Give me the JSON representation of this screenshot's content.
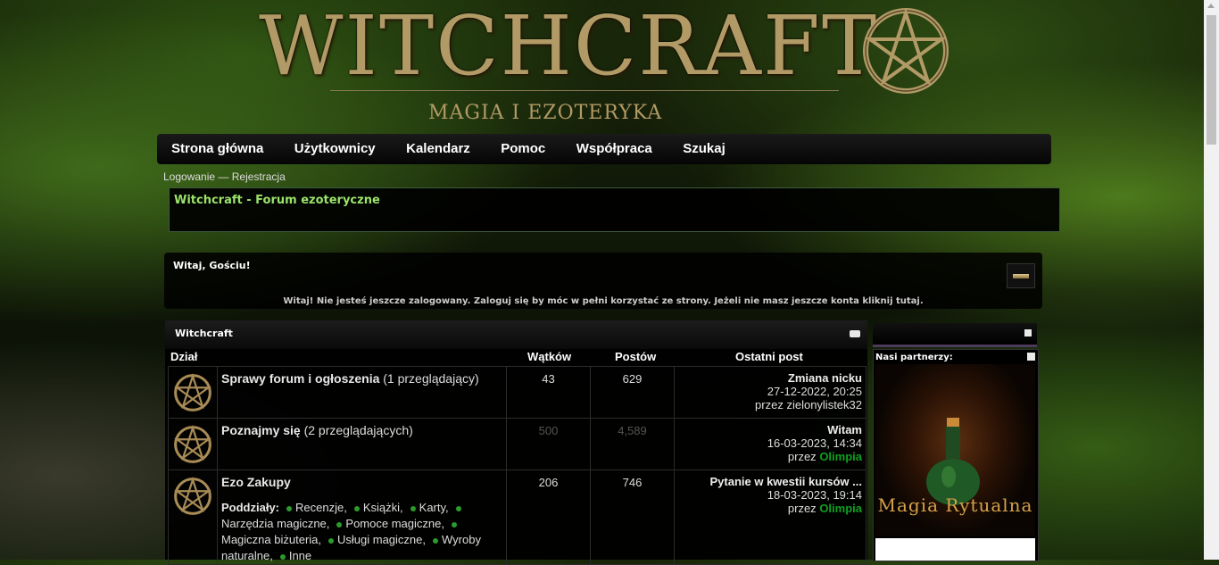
{
  "header": {
    "logo_title": "WITCHCRAFT",
    "logo_subtitle": "MAGIA I EZOTERYKA"
  },
  "nav": {
    "items": [
      "Strona główna",
      "Użytkownicy",
      "Kalendarz",
      "Pomoc",
      "Współpraca",
      "Szukaj"
    ]
  },
  "auth": {
    "login": "Logowanie",
    "separator": "—",
    "register": "Rejestracja"
  },
  "forum_title": "Witchcraft - Forum ezoteryczne",
  "welcome": {
    "heading": "Witaj, Gościu!",
    "text": "Witaj! Nie jesteś jeszcze zalogowany. Zaloguj się by móc w pełni korzystać ze strony. Jeżeli nie masz jeszcze konta kliknij tutaj."
  },
  "category": {
    "title": "Witchcraft",
    "columns": {
      "section": "Dział",
      "threads": "Wątków",
      "posts": "Postów",
      "last_post": "Ostatni post"
    },
    "forums": [
      {
        "name": "Sprawy forum i ogłoszenia",
        "viewers": "(1 przeglądający)",
        "threads": "43",
        "posts": "629",
        "last_title": "Zmiana nicku",
        "last_date": "27-12-2022, 20:25",
        "last_by_prefix": "przez",
        "last_user": "zielonylistek32"
      },
      {
        "name": "Poznajmy się",
        "viewers": "(2 przeglądających)",
        "threads": "500",
        "posts": "4,589",
        "last_title": "Witam",
        "last_date": "16-03-2023, 14:34",
        "last_by_prefix": "przez",
        "last_user": "Olimpia"
      },
      {
        "name": "Ezo Zakupy",
        "threads": "206",
        "posts": "746",
        "last_title": "Pytanie w kwestii kursów ...",
        "last_date": "18-03-2023, 19:14",
        "last_by_prefix": "przez",
        "last_user": "Olimpia",
        "subforums_label": "Poddziały:",
        "subforums": [
          "Recenzje",
          "Książki",
          "Karty",
          "Narzędzia magiczne",
          "Pomoce magiczne",
          "Magiczna biżuteria",
          "Usługi magiczne",
          "Wyroby naturalne",
          "Inne"
        ]
      }
    ]
  },
  "sidebar": {
    "partners_title": "Nasi partnerzy:",
    "banner_text": "Magia Rytualna"
  },
  "colors": {
    "title_green": "#9be36b",
    "user_green": "#0fa020",
    "logo_gold": "#b29a66"
  }
}
